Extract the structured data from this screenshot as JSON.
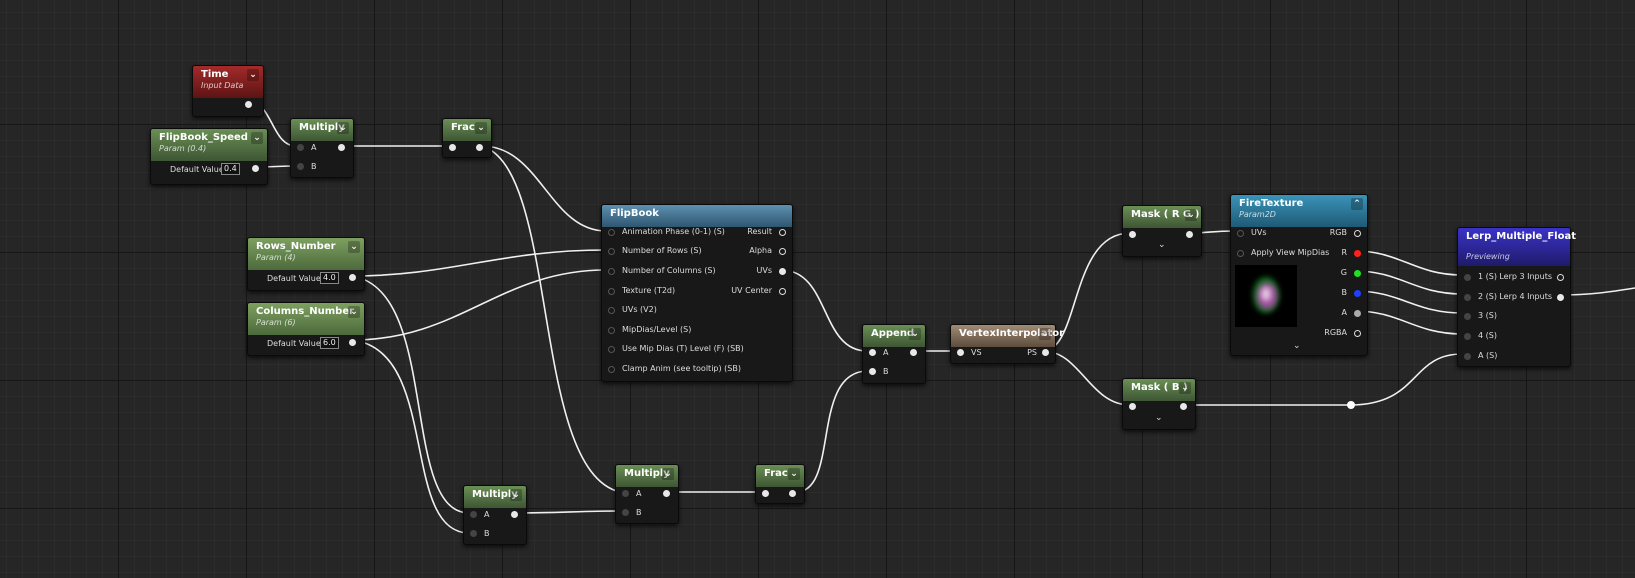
{
  "nodes": {
    "time": {
      "title": "Time",
      "subtitle": "Input Data"
    },
    "flipbook_speed": {
      "title": "FlipBook_Speed",
      "subtitle": "Param (0.4)",
      "field_label": "Default Value",
      "value": "0.4"
    },
    "multiply1": {
      "title": "Multiply",
      "in_a": "A",
      "in_b": "B"
    },
    "frac1": {
      "title": "Frac"
    },
    "rows_number": {
      "title": "Rows_Number",
      "subtitle": "Param (4)",
      "field_label": "Default Value",
      "value": "4.0"
    },
    "columns_number": {
      "title": "Columns_Number",
      "subtitle": "Param (6)",
      "field_label": "Default Value",
      "value": "6.0"
    },
    "flipbook": {
      "title": "FlipBook",
      "inputs": [
        "Animation  Phase (0-1) (S)",
        "Number of Rows (S)",
        "Number of Columns (S)",
        "Texture (T2d)",
        "UVs (V2)",
        "MipDias/Level (S)",
        "Use Mip Dias (T) Level (F) (SB)",
        "Clamp Anim (see tooltip) (SB)"
      ],
      "outputs": [
        "Result",
        "Alpha",
        "UVs",
        "UV Center"
      ]
    },
    "multiply2": {
      "title": "Multiply",
      "in_a": "A",
      "in_b": "B"
    },
    "multiply3": {
      "title": "Multiply",
      "in_a": "A",
      "in_b": "B"
    },
    "frac2": {
      "title": "Frac"
    },
    "append": {
      "title": "Append",
      "in_a": "A",
      "in_b": "B"
    },
    "vertex_interpolator": {
      "title": "VertexInterpolator",
      "in": "VS",
      "out": "PS"
    },
    "mask_rg": {
      "title": "Mask ( R G )"
    },
    "mask_b": {
      "title": "Mask ( B )"
    },
    "fire_texture": {
      "title": "FireTexture",
      "subtitle": "Param2D",
      "inputs": [
        "UVs",
        "Apply View MipDias"
      ],
      "outputs": [
        "RGB",
        "R",
        "G",
        "B",
        "A",
        "RGBA"
      ]
    },
    "lerp": {
      "title": "Lerp_Multiple_Float",
      "subtitle": "Previewing",
      "inputs": [
        "1 (S)",
        "2 (S)",
        "3 (S)",
        "4 (S)",
        "A (S)"
      ],
      "outputs": [
        "Lerp 3 Inputs",
        "Lerp 4 Inputs"
      ]
    }
  },
  "colors": {
    "wire": "#ffffff",
    "pin_r": "#ff2020",
    "pin_g": "#20e020",
    "pin_b": "#2040ff",
    "background": "#262626"
  },
  "icons": {
    "collapse": "chevron-down-icon",
    "expand": "chevron-down-icon"
  }
}
